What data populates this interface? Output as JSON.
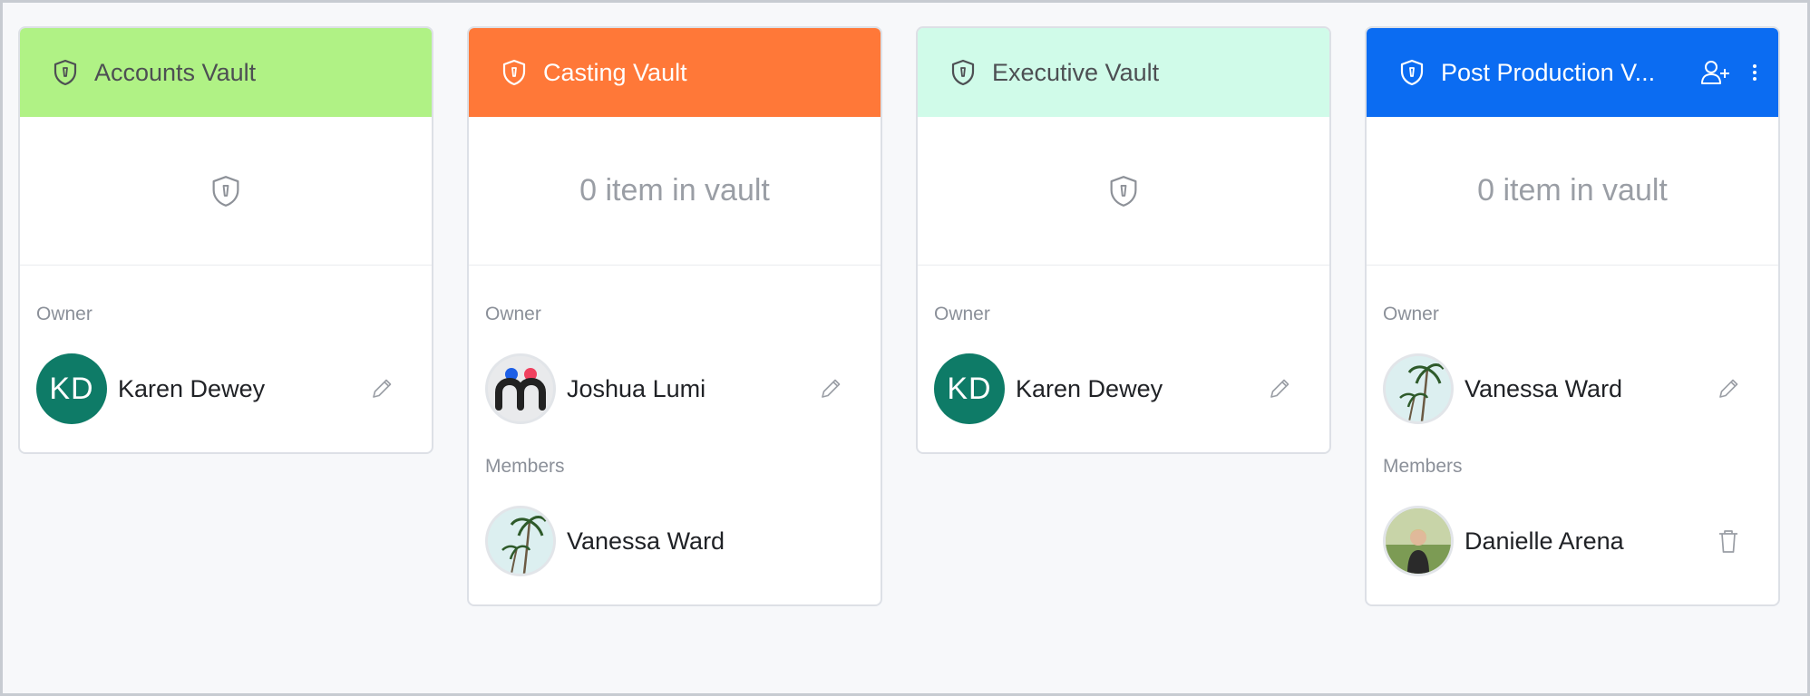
{
  "vaults": [
    {
      "title": "Accounts Vault",
      "header_bg": "#b0f285",
      "header_fg": "#4d4f53",
      "body_type": "icon",
      "owner_label": "Owner",
      "owner": {
        "name": "Karen Dewey",
        "avatar_type": "initials",
        "initials": "KD"
      }
    },
    {
      "title": "Casting Vault",
      "header_bg": "#ff7838",
      "header_fg": "#ffffff",
      "body_type": "count",
      "count_text": "0 item in vault",
      "owner_label": "Owner",
      "owner": {
        "name": "Joshua Lumi",
        "avatar_type": "logo"
      },
      "members_label": "Members",
      "member": {
        "name": "Vanessa Ward",
        "avatar_type": "palm"
      }
    },
    {
      "title": "Executive Vault",
      "header_bg": "#d0fbe9",
      "header_fg": "#4d4f53",
      "body_type": "icon",
      "owner_label": "Owner",
      "owner": {
        "name": "Karen Dewey",
        "avatar_type": "initials",
        "initials": "KD"
      }
    },
    {
      "title": "Post Production V...",
      "header_bg": "#0b6cf2",
      "header_fg": "#ffffff",
      "body_type": "count",
      "count_text": "0 item in vault",
      "owner_label": "Owner",
      "owner": {
        "name": "Vanessa Ward",
        "avatar_type": "palm"
      },
      "members_label": "Members",
      "member": {
        "name": "Danielle Arena",
        "avatar_type": "photo"
      }
    }
  ]
}
